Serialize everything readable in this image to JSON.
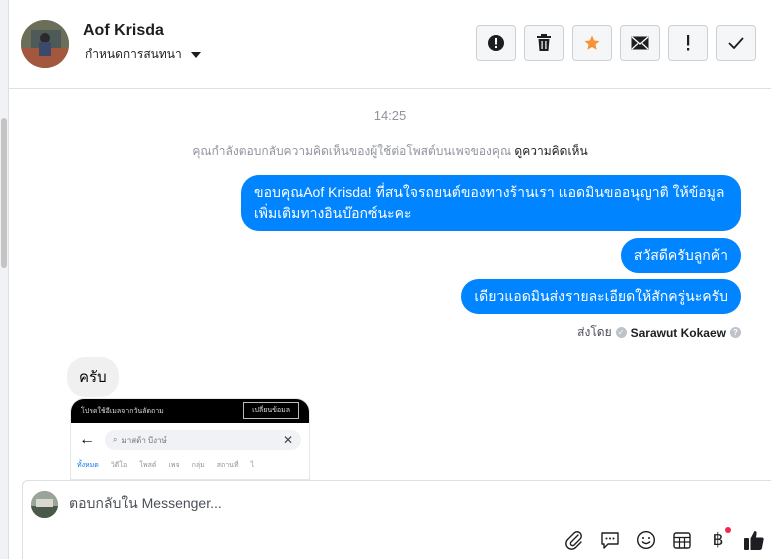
{
  "header": {
    "user_name": "Aof Krisda",
    "assign_label": "กำหนดการสนทนา",
    "actions": [
      {
        "name": "mark-spam",
        "icon": "alert-circle-icon"
      },
      {
        "name": "delete",
        "icon": "trash-icon"
      },
      {
        "name": "star",
        "icon": "star-icon"
      },
      {
        "name": "mark-unread",
        "icon": "envelope-icon"
      },
      {
        "name": "follow-up",
        "icon": "exclamation-icon"
      },
      {
        "name": "mark-done",
        "icon": "checkmark-icon"
      }
    ]
  },
  "conversation": {
    "time": "14:25",
    "notice_text": "คุณกำลังตอบกลับความคิดเห็นของผู้ใช้ต่อโพสต์บนเพจของคุณ",
    "notice_link": "ดูความคิดเห็น",
    "outgoing": [
      "ขอบคุณAof Krisda! ที่สนใจรถยนต์ของทางร้านเรา แอดมินขออนุญาติ ให้ข้อมูลเพิ่มเติมทางอินบ๊อกซ์นะคะ",
      "สวัสดีครับลูกค้า",
      "เดียวแอดมินส่งรายละเอียดให้สักครู่นะครับ"
    ],
    "sent_by_label": "ส่งโดย",
    "sent_by_agent": "Sarawut Kokaew",
    "incoming": [
      "ครับ"
    ],
    "attachment": {
      "top_text": "โปรดใช้อีเมลจากวันลัดถาม",
      "top_button": "เปลี่ยนข้อมล",
      "search_text": "มาสด้า บีงาษ์",
      "tabs": [
        "ทั้งหมด",
        "วิดีโอ",
        "โพสต์",
        "เพจ",
        "กลุ่ม",
        "สถานที่",
        "ไ"
      ]
    }
  },
  "composer": {
    "placeholder": "ตอบกลับใน Messenger...",
    "tools": [
      "paperclip-icon",
      "saved-reply-icon",
      "emoji-icon",
      "appointment-icon",
      "payment-icon",
      "like-icon"
    ]
  },
  "colors": {
    "accent": "#0084ff",
    "star": "#f7923b",
    "incoming_bubble": "#f1f0f0"
  }
}
